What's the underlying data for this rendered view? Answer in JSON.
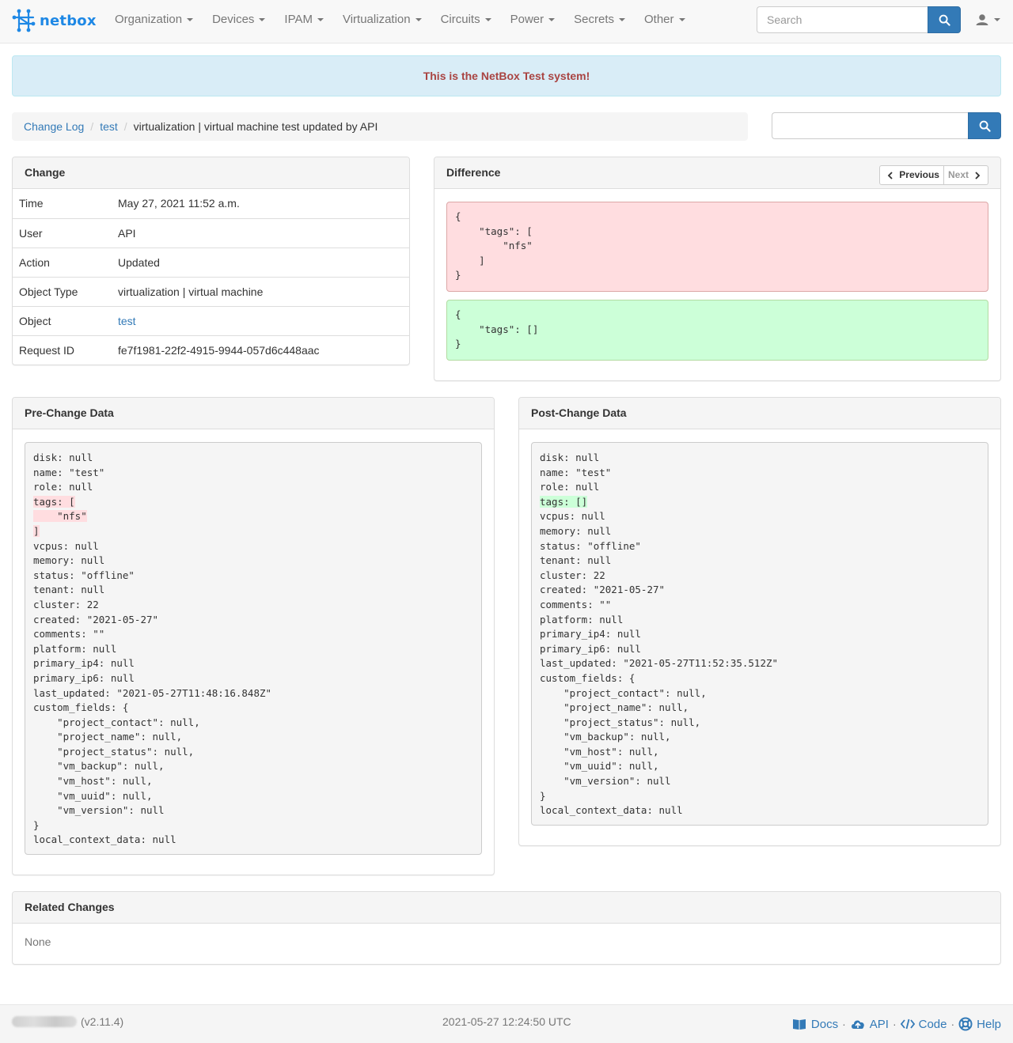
{
  "app": {
    "brand": "netbox"
  },
  "nav": {
    "menus": [
      "Organization",
      "Devices",
      "IPAM",
      "Virtualization",
      "Circuits",
      "Power",
      "Secrets",
      "Other"
    ],
    "search_placeholder": "Search"
  },
  "banner": "This is the NetBox Test system!",
  "breadcrumb": {
    "items": [
      "Change Log",
      "test"
    ],
    "current": "virtualization | virtual machine test updated by API"
  },
  "change": {
    "title": "Change",
    "rows": [
      {
        "label": "Time",
        "value": "May 27, 2021 11:52 a.m."
      },
      {
        "label": "User",
        "value": "API"
      },
      {
        "label": "Action",
        "value": "Updated"
      },
      {
        "label": "Object Type",
        "value": "virtualization | virtual machine"
      },
      {
        "label": "Object",
        "value": "test"
      },
      {
        "label": "Request ID",
        "value": "fe7f1981-22f2-4915-9944-057d6c448aac"
      }
    ]
  },
  "difference": {
    "title": "Difference",
    "previous_label": "Previous",
    "next_label": "Next",
    "removed": "{\n    \"tags\": [\n        \"nfs\"\n    ]\n}",
    "added": "{\n    \"tags\": []\n}"
  },
  "pre_change": {
    "title": "Pre-Change Data",
    "before": "disk: null\nname: \"test\"\nrole: null",
    "highlight": "tags: [\n    \"nfs\"\n]",
    "after": "vcpus: null\nmemory: null\nstatus: \"offline\"\ntenant: null\ncluster: 22\ncreated: \"2021-05-27\"\ncomments: \"\"\nplatform: null\nprimary_ip4: null\nprimary_ip6: null\nlast_updated: \"2021-05-27T11:48:16.848Z\"\ncustom_fields: {\n    \"project_contact\": null,\n    \"project_name\": null,\n    \"project_status\": null,\n    \"vm_backup\": null,\n    \"vm_host\": null,\n    \"vm_uuid\": null,\n    \"vm_version\": null\n}\nlocal_context_data: null"
  },
  "post_change": {
    "title": "Post-Change Data",
    "before": "disk: null\nname: \"test\"\nrole: null",
    "highlight": "tags: []",
    "after": "vcpus: null\nmemory: null\nstatus: \"offline\"\ntenant: null\ncluster: 22\ncreated: \"2021-05-27\"\ncomments: \"\"\nplatform: null\nprimary_ip4: null\nprimary_ip6: null\nlast_updated: \"2021-05-27T11:52:35.512Z\"\ncustom_fields: {\n    \"project_contact\": null,\n    \"project_name\": null,\n    \"project_status\": null,\n    \"vm_backup\": null,\n    \"vm_host\": null,\n    \"vm_uuid\": null,\n    \"vm_version\": null\n}\nlocal_context_data: null"
  },
  "related": {
    "title": "Related Changes",
    "body": "None"
  },
  "footer": {
    "version": "(v2.11.4)",
    "timestamp": "2021-05-27 12:24:50 UTC",
    "links": [
      "Docs",
      "API",
      "Code",
      "Help"
    ]
  },
  "icons": {
    "brand": "netbox-logo-icon",
    "search": "search-icon",
    "user": "user-icon",
    "prev": "chevron-left-icon",
    "next": "chevron-right-icon",
    "docs": "book-icon",
    "api": "cloud-icon",
    "code": "code-icon",
    "help": "lifebuoy-icon"
  },
  "colors": {
    "brand": "#1e88e5",
    "link": "#337ab7",
    "banner_text": "#a94442",
    "banner_bg": "#d9edf7",
    "removed_bg": "#ffdde0",
    "added_bg": "#ccffd8"
  }
}
